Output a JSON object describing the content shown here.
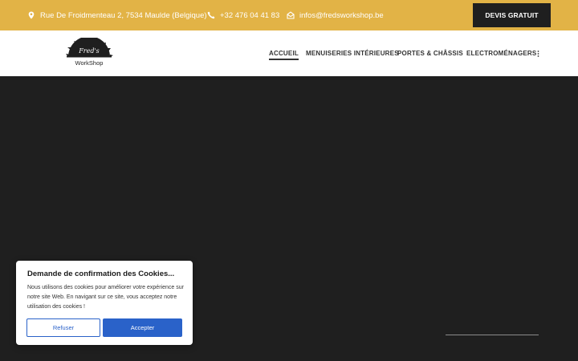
{
  "topbar": {
    "address": "Rue De Froidmenteau 2, 7534 Maulde (Belgique)",
    "phone": "+32 476 04 41 83",
    "email": "infos@fredsworkshop.be",
    "cta_label": "DEVIS GRATUIT",
    "bg_color": "#e2b346"
  },
  "logo": {
    "line1": "Fred's",
    "line2": "WorkShop"
  },
  "nav": {
    "items": [
      {
        "label": "ACCUEIL",
        "active": true
      },
      {
        "label": "MENUISERIES INTÉRIEURES"
      },
      {
        "label": "PORTES & CHÂSSIS"
      },
      {
        "label": "ELECTROMÉNAGERS"
      }
    ],
    "more_icon": "vertical-dots-icon"
  },
  "cookie_banner": {
    "title": "Demande de confirmation des Cookies...",
    "text": "Nous utilisons des cookies pour améliorer votre expérience sur notre site Web. En navigant sur ce site, vous acceptez notre utilisation des cookies !",
    "refuse_label": "Refuser",
    "accept_label": "Accepter",
    "accent_color": "#2a62c9"
  },
  "icons": [
    "map-pin-icon",
    "phone-icon",
    "envelope-icon",
    "saw-blade-logo"
  ]
}
